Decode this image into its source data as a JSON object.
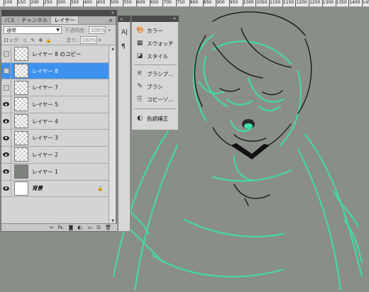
{
  "ruler": {
    "labels": [
      "100",
      "150",
      "200",
      "250",
      "300",
      "350",
      "400",
      "450",
      "500",
      "550",
      "600",
      "650",
      "700",
      "750",
      "800",
      "850",
      "900",
      "950",
      "1000",
      "1050",
      "1100",
      "1150",
      "1200",
      "1250",
      "1300",
      "1350",
      "1400",
      "1450"
    ]
  },
  "layers_panel": {
    "tabs": [
      {
        "label": "パス",
        "active": false
      },
      {
        "label": "チャンネル",
        "active": false
      },
      {
        "label": "レイヤー",
        "active": true
      }
    ],
    "menu_icon": "≡",
    "blend_mode": "通常",
    "opacity_label": "不透明度:",
    "opacity_value": "100%",
    "lock_label": "ロック:",
    "fill_label": "塗り:",
    "fill_value": "100%",
    "layers": [
      {
        "name": "レイヤー 8 のコピー",
        "visible": false,
        "selected": false,
        "thumb": "checker",
        "locked": false,
        "italic": false
      },
      {
        "name": "レイヤー 8",
        "visible": false,
        "selected": true,
        "thumb": "checker",
        "locked": false,
        "italic": false
      },
      {
        "name": "レイヤー 7",
        "visible": false,
        "selected": false,
        "thumb": "checker",
        "locked": false,
        "italic": false
      },
      {
        "name": "レイヤー 5",
        "visible": true,
        "selected": false,
        "thumb": "checker",
        "locked": false,
        "italic": false
      },
      {
        "name": "レイヤー 4",
        "visible": true,
        "selected": false,
        "thumb": "checker",
        "locked": false,
        "italic": false
      },
      {
        "name": "レイヤー 3",
        "visible": true,
        "selected": false,
        "thumb": "checker",
        "locked": false,
        "italic": false
      },
      {
        "name": "レイヤー 2",
        "visible": true,
        "selected": false,
        "thumb": "checker",
        "locked": false,
        "italic": false
      },
      {
        "name": "レイヤー 1",
        "visible": true,
        "selected": false,
        "thumb": "gray",
        "locked": false,
        "italic": false
      },
      {
        "name": "背景",
        "visible": true,
        "selected": false,
        "thumb": "white",
        "locked": true,
        "italic": true
      }
    ],
    "bottom_icons": [
      "link-icon",
      "fx-icon",
      "mask-icon",
      "adjustment-icon",
      "folder-icon",
      "new-layer-icon",
      "trash-icon"
    ],
    "bottom_glyphs": [
      "∞",
      "fx.",
      "◙",
      "◐.",
      "▭",
      "⊡",
      "🗑"
    ]
  },
  "dock_items": [
    {
      "label": "カラー",
      "icon": "palette-icon",
      "glyph": "🎨"
    },
    {
      "label": "スウォッチ",
      "icon": "swatches-icon",
      "glyph": "▦"
    },
    {
      "label": "スタイル",
      "icon": "styles-icon",
      "glyph": "◪"
    },
    {
      "label": "ブラシプ...",
      "icon": "brush-presets-icon",
      "glyph": "⚟"
    },
    {
      "label": "ブラシ",
      "icon": "brush-icon",
      "glyph": "✎"
    },
    {
      "label": "コピーソ...",
      "icon": "clone-source-icon",
      "glyph": "⎘"
    },
    {
      "label": "色調補正",
      "icon": "adjustments-icon",
      "glyph": "◐"
    }
  ],
  "strip_icons": [
    {
      "glyph": "A|",
      "icon": "character-icon"
    },
    {
      "glyph": "¶",
      "icon": "paragraph-icon"
    }
  ],
  "colors": {
    "canvas": "#8a8e88",
    "line_green": "#3fe0a8",
    "selection": "#3e92ef"
  }
}
